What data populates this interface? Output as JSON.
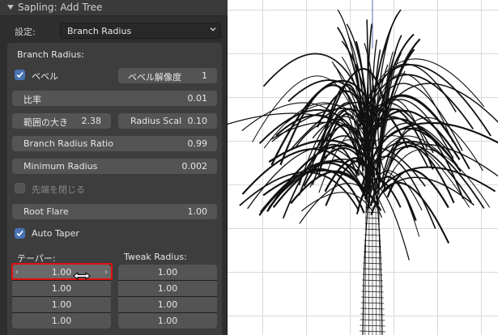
{
  "panel": {
    "title": "Sapling: Add Tree",
    "preset_label": "設定:",
    "preset_value": "Branch Radius",
    "section_title": "Branch Radius:"
  },
  "fields": {
    "bevel": {
      "label": "ベベル",
      "checked": true
    },
    "bevel_resolution": {
      "label": "ベベル解像度",
      "value": "1"
    },
    "ratio": {
      "label": "比率",
      "value": "0.01"
    },
    "range_size": {
      "label": "範囲の大き",
      "value": "2.38"
    },
    "radius_scale": {
      "label": "Radius Scal",
      "value": "0.10"
    },
    "branch_radius_ratio": {
      "label": "Branch Radius Ratio",
      "value": "0.99"
    },
    "minimum_radius": {
      "label": "Minimum Radius",
      "value": "0.002"
    },
    "close_tip": {
      "label": "先端を閉じる",
      "checked": false
    },
    "root_flare": {
      "label": "Root Flare",
      "value": "1.00"
    },
    "auto_taper": {
      "label": "Auto Taper",
      "checked": true
    }
  },
  "taper": {
    "label": "テーパー:",
    "values": [
      "1.00",
      "1.00",
      "1.00",
      "1.00"
    ]
  },
  "tweak_radius": {
    "label": "Tweak Radius:",
    "values": [
      "1.00",
      "1.00",
      "1.00",
      "1.00"
    ]
  },
  "icons": {
    "collapse": "triangle-down-icon",
    "dropdown": "chevron-down-icon",
    "check": "checkmark-icon",
    "cursor": "arrow-cursor-icon"
  },
  "colors": {
    "panel_bg": "#2e2e2e",
    "subpanel_bg": "#3d3d3d",
    "field_bg": "#545454",
    "checkbox_on": "#4772b3",
    "highlight_box": "#e01010",
    "viewport_bg": "#ffffff"
  }
}
